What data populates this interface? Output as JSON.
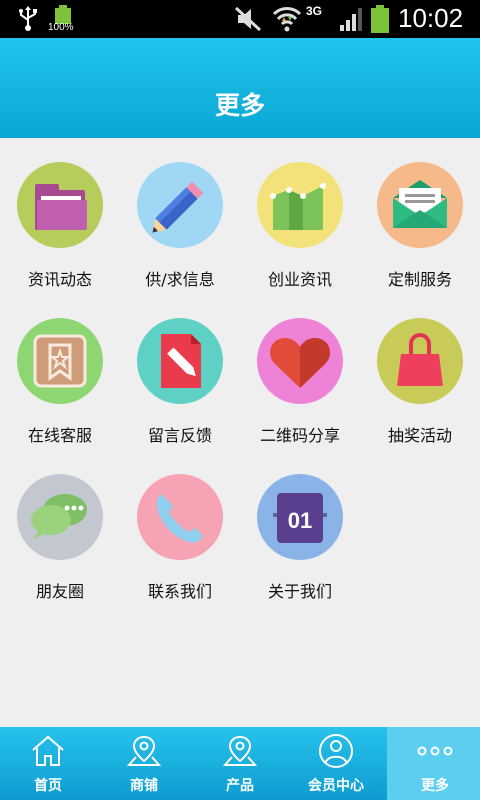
{
  "status_bar": {
    "battery_small_pct": "100%",
    "network": "3G",
    "time": "10:02"
  },
  "header": {
    "title": "更多"
  },
  "grid_items": [
    {
      "label": "资讯动态",
      "icon": "folder-icon",
      "bg": "#b6cd5c"
    },
    {
      "label": "供/求信息",
      "icon": "pencil-icon",
      "bg": "#9fd7f4"
    },
    {
      "label": "创业资讯",
      "icon": "chart-icon",
      "bg": "#f3e27a"
    },
    {
      "label": "定制服务",
      "icon": "envelope-icon",
      "bg": "#f5b98a"
    },
    {
      "label": "在线客服",
      "icon": "bookmark-star-icon",
      "bg": "#8ed672"
    },
    {
      "label": "留言反馈",
      "icon": "document-edit-icon",
      "bg": "#5ed1c4"
    },
    {
      "label": "二维码分享",
      "icon": "heart-icon",
      "bg": "#ee82d6"
    },
    {
      "label": "抽奖活动",
      "icon": "shopping-bag-icon",
      "bg": "#c9cb59"
    },
    {
      "label": "朋友圈",
      "icon": "chat-bubble-icon",
      "bg": "#c3c7cf"
    },
    {
      "label": "联系我们",
      "icon": "phone-icon",
      "bg": "#f6a3b3"
    },
    {
      "label": "关于我们",
      "icon": "calendar-icon",
      "bg": "#8ab4e8",
      "badge": "01"
    }
  ],
  "bottom_nav": [
    {
      "label": "首页",
      "icon": "home-icon"
    },
    {
      "label": "商铺",
      "icon": "map-pin-icon"
    },
    {
      "label": "产品",
      "icon": "map-pin-icon"
    },
    {
      "label": "会员中心",
      "icon": "user-icon"
    },
    {
      "label": "更多",
      "icon": "more-dots-icon",
      "active": true
    }
  ]
}
